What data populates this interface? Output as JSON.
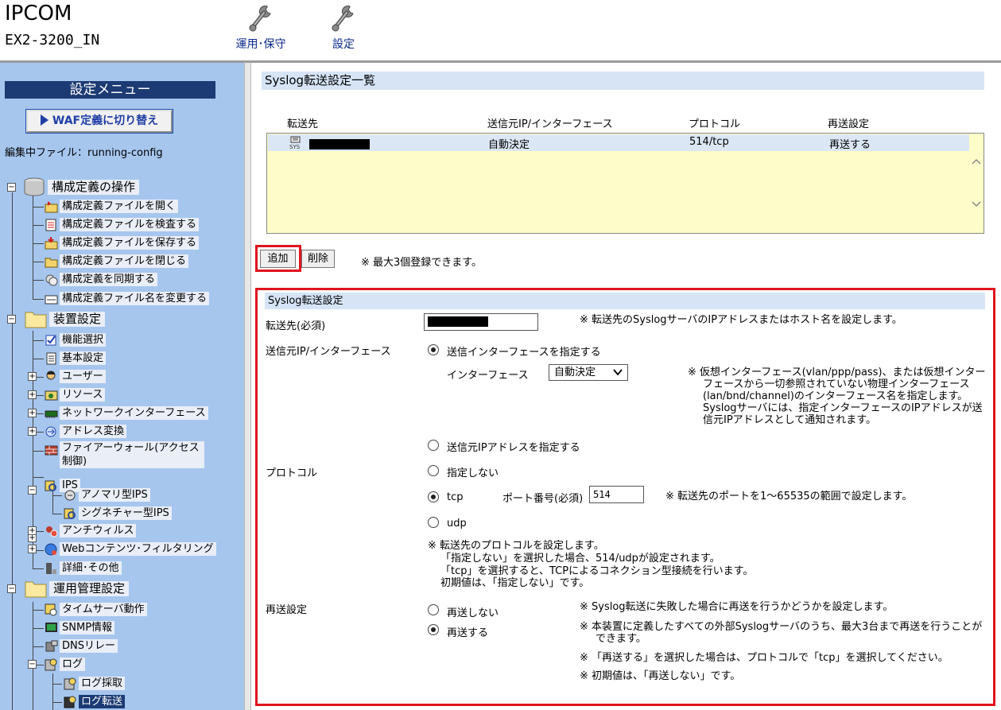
{
  "header": {
    "brand": "IPCOM",
    "model": "EX2-3200_IN",
    "nav": [
      {
        "label": "運用･保守",
        "icon": "wrench-icon"
      },
      {
        "label": "設定",
        "icon": "wrench-icon"
      }
    ]
  },
  "sidebar": {
    "title": "設定メニュー",
    "waf_button": "WAF定義に切り替え",
    "editing_file": "編集中ファイル：running-config",
    "groups": [
      {
        "label": "構成定義の操作",
        "icon": "database-icon",
        "items": [
          {
            "label": "構成定義ファイルを開く",
            "icon": "folder-open-icon"
          },
          {
            "label": "構成定義ファイルを検査する",
            "icon": "checklist-icon"
          },
          {
            "label": "構成定義ファイルを保存する",
            "icon": "folder-save-icon"
          },
          {
            "label": "構成定義ファイルを閉じる",
            "icon": "folder-icon"
          },
          {
            "label": "構成定義を同期する",
            "icon": "sync-icon"
          },
          {
            "label": "構成定義ファイル名を変更する",
            "icon": "rename-icon"
          }
        ]
      },
      {
        "label": "装置設定",
        "icon": "folder-icon",
        "items": [
          {
            "label": "機能選択",
            "icon": "checkbox-icon"
          },
          {
            "label": "基本設定",
            "icon": "document-icon"
          },
          {
            "label": "ユーザー",
            "icon": "user-icon",
            "expandable": true
          },
          {
            "label": "リソース",
            "icon": "resource-icon",
            "expandable": true
          },
          {
            "label": "ネットワークインターフェース",
            "icon": "network-card-icon",
            "expandable": true
          },
          {
            "label": "アドレス変換",
            "icon": "address-translation-icon",
            "expandable": true
          },
          {
            "label": "ファイアーウォール(アクセス制御)",
            "icon": "firewall-icon"
          },
          {
            "label": "IPS",
            "icon": "ips-icon",
            "expanded": true
          },
          {
            "label": "アノマリ型IPS",
            "icon": "anomaly-ips-icon"
          },
          {
            "label": "シグネチャー型IPS",
            "icon": "signature-ips-icon"
          },
          {
            "label": "アンチウィルス",
            "icon": "antivirus-icon",
            "expandable": true
          },
          {
            "label": "Webコンテンツ･フィルタリング",
            "icon": "web-filter-icon",
            "expandable": true
          },
          {
            "label": "詳細･その他",
            "icon": "detail-icon"
          }
        ]
      },
      {
        "label": "運用管理設定",
        "icon": "folder-icon",
        "items": [
          {
            "label": "タイムサーバ動作",
            "icon": "time-server-icon"
          },
          {
            "label": "SNMP情報",
            "icon": "snmp-icon"
          },
          {
            "label": "DNSリレー",
            "icon": "dns-icon"
          },
          {
            "label": "ログ",
            "icon": "log-icon",
            "expanded": true
          },
          {
            "label": "ログ採取",
            "icon": "log-collect-icon"
          },
          {
            "label": "ログ転送",
            "icon": "log-forward-icon",
            "selected": true
          }
        ]
      }
    ]
  },
  "list": {
    "title": "Syslog転送設定一覧",
    "columns": [
      "転送先",
      "送信元IP/インターフェース",
      "プロトコル",
      "再送設定"
    ],
    "rows": [
      {
        "destination": "",
        "source": "自動決定",
        "protocol": "514/tcp",
        "resend": "再送する"
      }
    ]
  },
  "actions": {
    "add": "追加",
    "delete": "削除",
    "note": "※ 最大3個登録できます。"
  },
  "form": {
    "title": "Syslog転送設定",
    "destination": {
      "label": "転送先(必須)",
      "value": "",
      "note": "※ 転送先のSyslogサーバのIPアドレスまたはホスト名を設定します。"
    },
    "source": {
      "label": "送信元IP/インターフェース",
      "option_interface": "送信インターフェースを指定する",
      "interface_label": "インターフェース",
      "interface_value": "自動決定",
      "interface_note": [
        "※ 仮想インターフェース(vlan/ppp/pass)、または仮想インター",
        "フェースから一切参照されていない物理インターフェース",
        "(lan/bnd/channel)のインターフェース名を指定します。",
        "Syslogサーバには、指定インターフェースのIPアドレスが送",
        "信元IPアドレスとして通知されます。"
      ],
      "option_ip": "送信元IPアドレスを指定する"
    },
    "protocol": {
      "label": "プロトコル",
      "option_none": "指定しない",
      "option_tcp": "tcp",
      "port_label": "ポート番号(必須)",
      "port_value": "514",
      "port_note": "※  転送先のポートを1～65535の範囲で設定します。",
      "option_udp": "udp",
      "notes": [
        "※ 転送先のプロトコルを設定します。",
        "「指定しない」を選択した場合、514/udpが設定されます。",
        "「tcp」を選択すると、TCPによるコネクション型接続を行います。",
        "初期値は、「指定しない」です。"
      ]
    },
    "resend": {
      "label": "再送設定",
      "option_no": "再送しない",
      "option_yes": "再送する",
      "notes": [
        "※  Syslog転送に失敗した場合に再送を行うかどうかを設定します。",
        "※  本装置に定義したすべての外部Syslogサーバのうち、最大3台まで再送を行うことが",
        "できます。",
        "※  「再送する」を選択した場合は、プロトコルで「tcp」を選択してください。",
        "※  初期値は、「再送しない」です。"
      ]
    }
  }
}
